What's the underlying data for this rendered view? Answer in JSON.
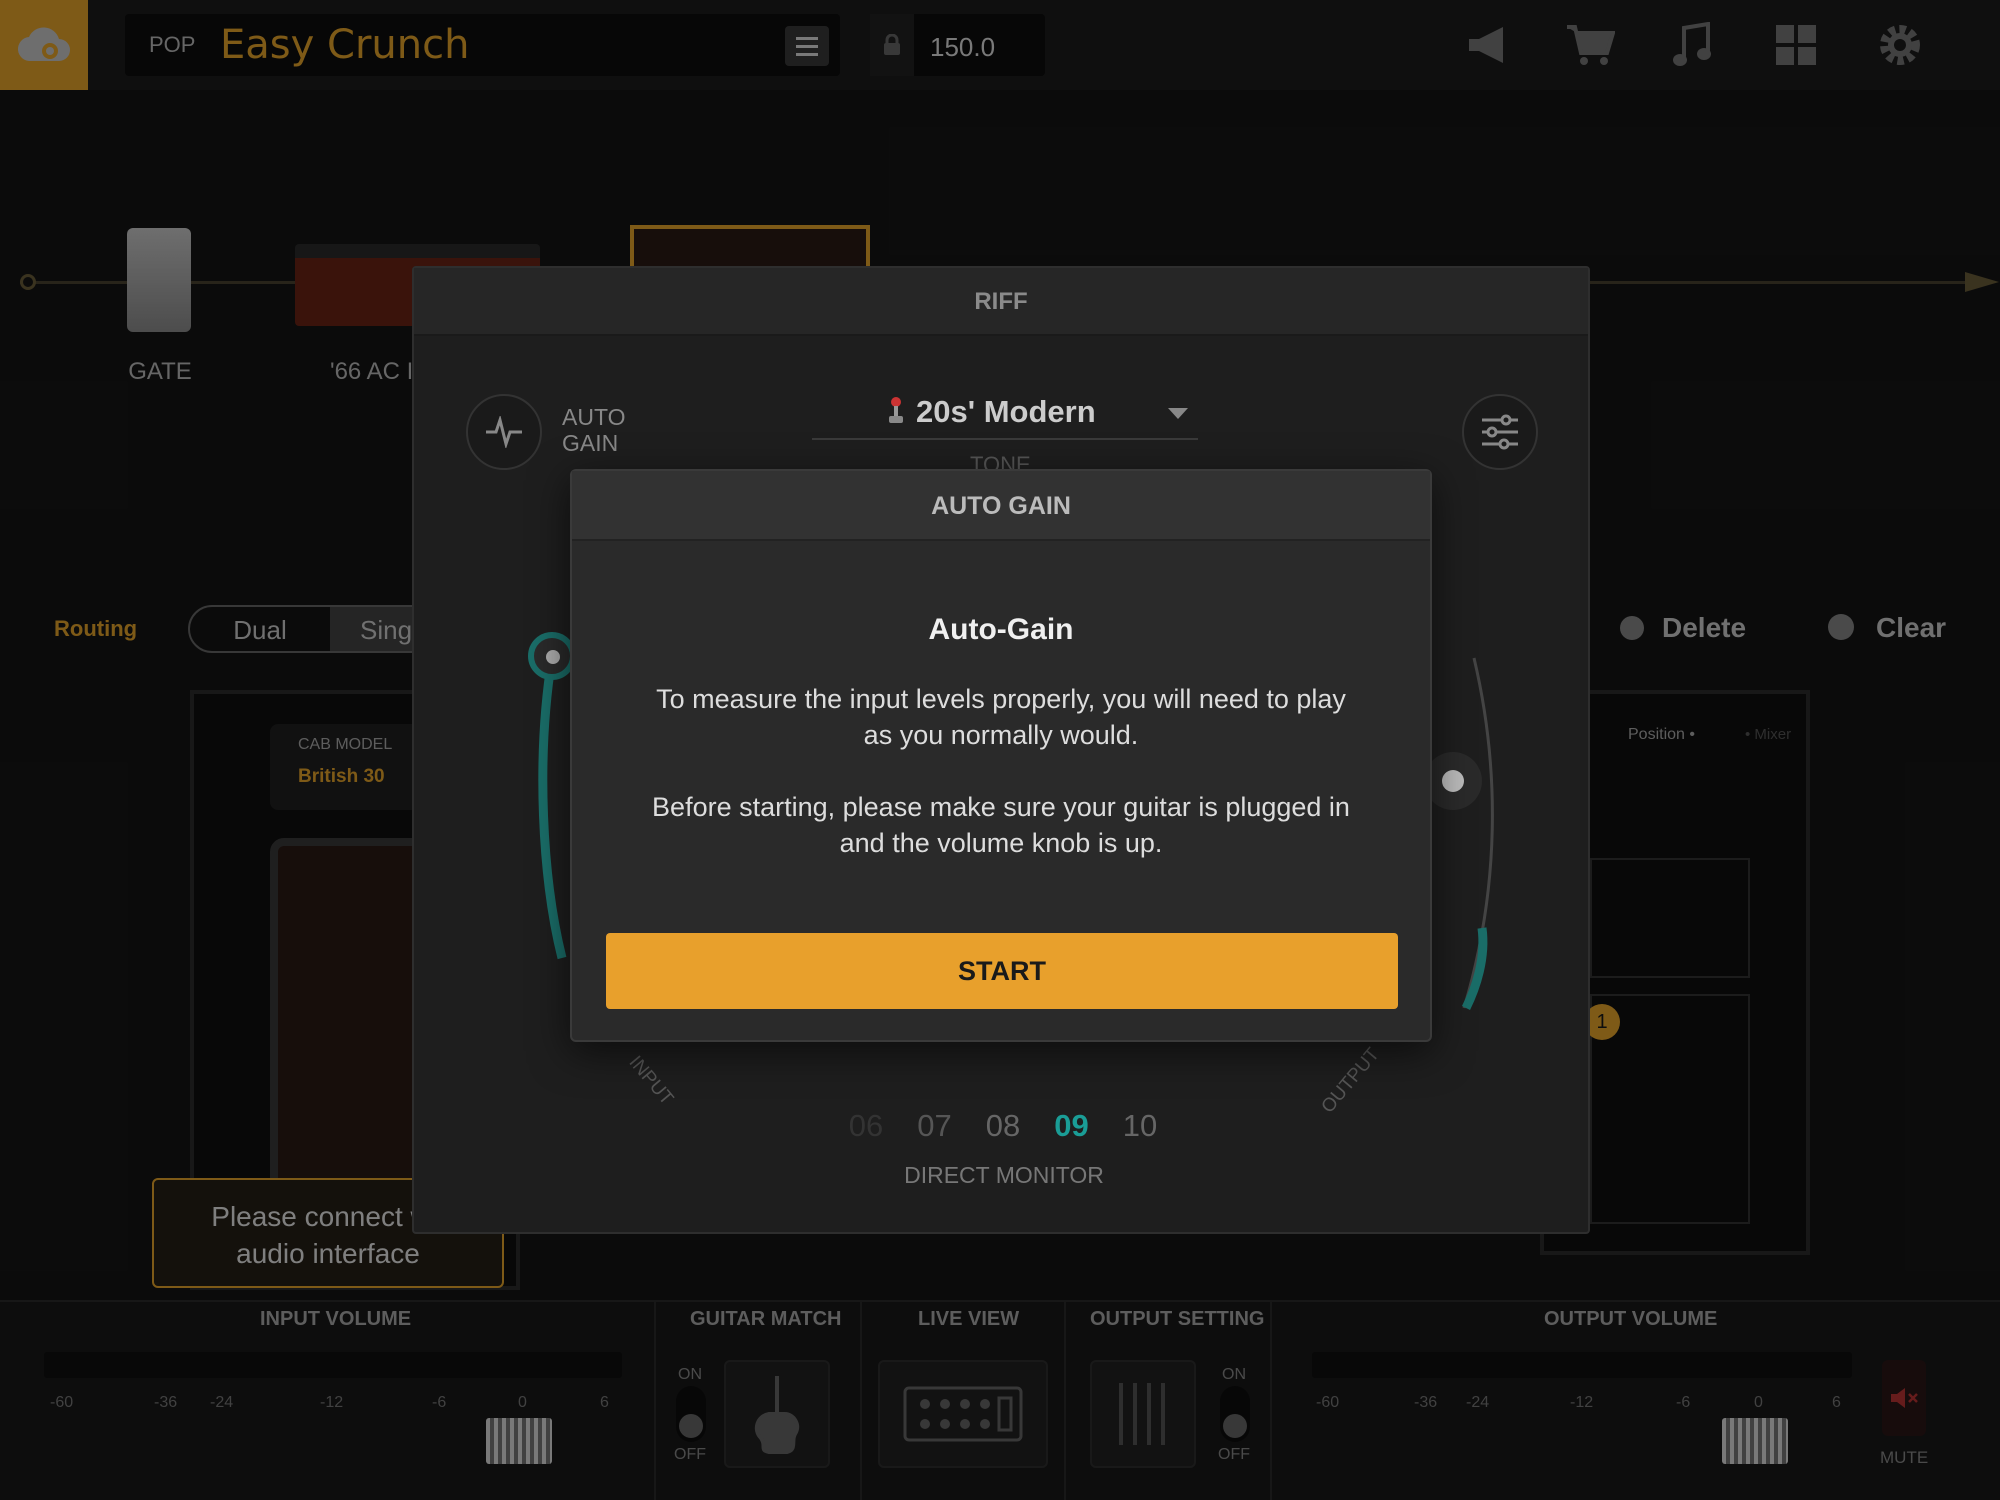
{
  "topbar": {
    "genre": "POP",
    "preset_name": "Easy Crunch",
    "bpm": "150.0",
    "icons": [
      "cloud-icon",
      "hamburger-icon",
      "lock-icon",
      "megaphone-icon",
      "cart-icon",
      "music-note-icon",
      "grid-icon",
      "gear-icon"
    ]
  },
  "chain": {
    "gate_label": "GATE",
    "amp_label": "'66 AC I"
  },
  "routing": {
    "label": "Routing",
    "dual": "Dual",
    "single": "Sing",
    "delete": "Delete",
    "clear": "Clear"
  },
  "cab": {
    "model_title": "CAB MODEL",
    "model_name": "British 30",
    "position": "Position •",
    "mixer": "• Mixer",
    "mic_badge": "1"
  },
  "tooltip": {
    "line1": "Please connect wit",
    "line2": "audio interface"
  },
  "bottom": {
    "input_volume": "INPUT VOLUME",
    "guitar_match": "GUITAR MATCH",
    "live_view": "LIVE VIEW",
    "output_setting": "OUTPUT SETTING",
    "output_volume": "OUTPUT VOLUME",
    "ticks": [
      "-60",
      "-36",
      "-24",
      "-12",
      "-6",
      "0",
      "6"
    ],
    "on": "ON",
    "off": "OFF",
    "mute": "MUTE"
  },
  "riff": {
    "title": "RIFF",
    "auto_gain_label_1": "AUTO",
    "auto_gain_label_2": "GAIN",
    "tone_value": "20s' Modern",
    "tone_label": "TONE",
    "input_label": "INPUT",
    "output_label": "OUTPUT",
    "monitor_values": [
      "06",
      "07",
      "08",
      "09",
      "10"
    ],
    "monitor_selected": "09",
    "monitor_label": "DIRECT MONITOR"
  },
  "auto_gain_modal": {
    "header": "AUTO GAIN",
    "title": "Auto-Gain",
    "paragraph1": "To measure the input levels properly, you will need to play as you normally would.",
    "paragraph2": "Before starting, please make sure your guitar is plugged in and the volume knob is up.",
    "start": "START"
  },
  "colors": {
    "accent": "#e6a52a",
    "teal": "#1a9d96",
    "modal_bg": "#2a2a2a"
  }
}
